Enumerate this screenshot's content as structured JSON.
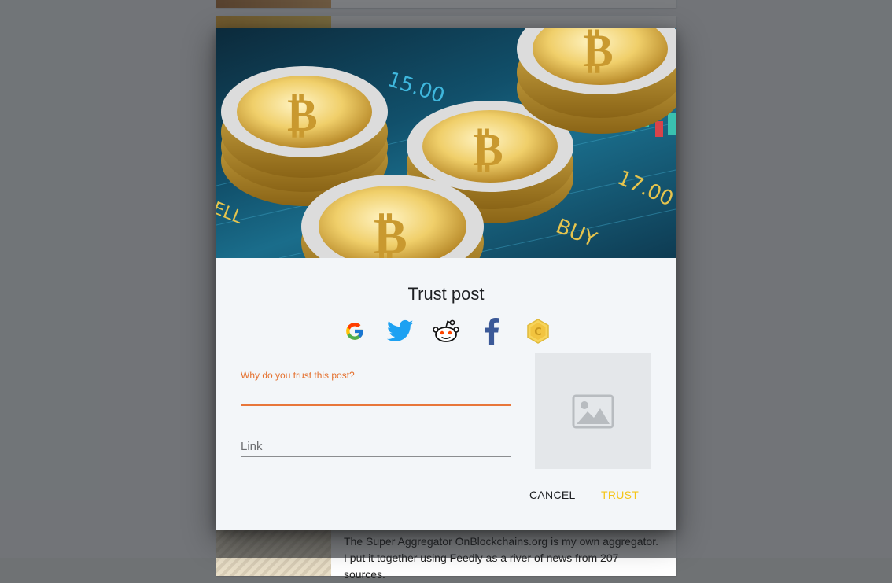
{
  "background": {
    "article_text": "The Super Aggregator OnBlockchains.org is my own aggregator. I put it together using Feedly as a river of news from 207 sources."
  },
  "dialog": {
    "title": "Trust post",
    "share_icons": [
      "google-icon",
      "twitter-icon",
      "reddit-icon",
      "facebook-icon",
      "coin-icon"
    ],
    "trust_field": {
      "label": "Why do you trust this post?",
      "value": ""
    },
    "link_field": {
      "placeholder": "Link",
      "value": ""
    },
    "image_placeholder_icon": "image-icon",
    "hero_image": {
      "text_labels": [
        "15.00",
        "17.00",
        "BUY",
        "ELL"
      ]
    },
    "actions": {
      "cancel_label": "CANCEL",
      "trust_label": "TRUST"
    }
  },
  "colors": {
    "accent_orange": "#e8763a",
    "trust_yellow": "#f5c518",
    "dialog_bg": "#f3f6f9"
  }
}
